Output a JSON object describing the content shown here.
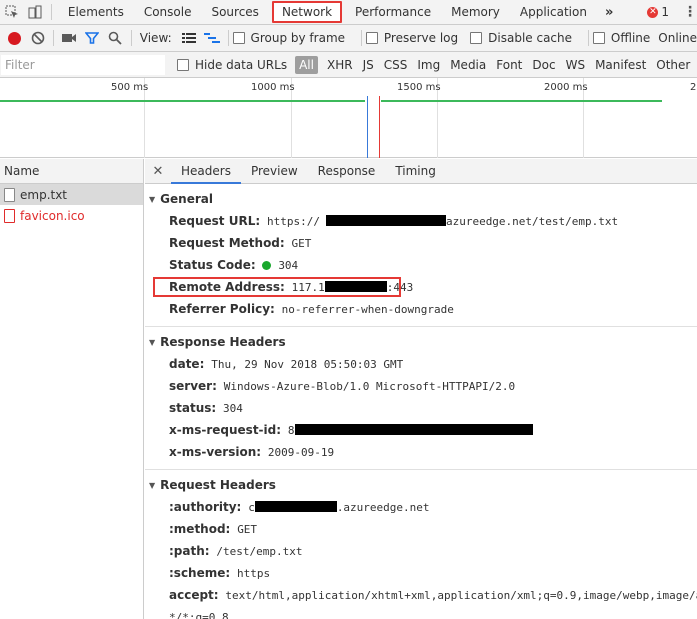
{
  "tabs": [
    "Elements",
    "Console",
    "Sources",
    "Network",
    "Performance",
    "Memory",
    "Application"
  ],
  "more": "»",
  "error_count": "1",
  "error_glyph": "✕",
  "toolbar": {
    "view_label": "View:",
    "group_by_frame": "Group by frame",
    "preserve_log": "Preserve log",
    "disable_cache": "Disable cache",
    "offline": "Offline",
    "online": "Online"
  },
  "filter": {
    "placeholder": "Filter",
    "hide_data_urls": "Hide data URLs",
    "types": [
      "All",
      "XHR",
      "JS",
      "CSS",
      "Img",
      "Media",
      "Font",
      "Doc",
      "WS",
      "Manifest",
      "Other"
    ]
  },
  "overview": {
    "ticks": [
      "500 ms",
      "1000 ms",
      "1500 ms",
      "2000 ms",
      "2"
    ]
  },
  "names": {
    "header": "Name",
    "rows": [
      "emp.txt",
      "favicon.ico"
    ]
  },
  "detail_tabs": [
    "Headers",
    "Preview",
    "Response",
    "Timing"
  ],
  "general": {
    "title": "General",
    "request_url_k": "Request URL:",
    "request_url_v1": "https://",
    "request_url_v2": "azureedge.net/test/emp.txt",
    "request_method_k": "Request Method:",
    "request_method_v": "GET",
    "status_code_k": "Status Code:",
    "status_code_v": "304",
    "remote_address_k": "Remote Address:",
    "remote_address_v1": "117.1",
    "remote_address_v2": ":443",
    "referrer_policy_k": "Referrer Policy:",
    "referrer_policy_v": "no-referrer-when-downgrade"
  },
  "response_headers": {
    "title": "Response Headers",
    "date_k": "date:",
    "date_v": "Thu, 29 Nov 2018 05:50:03 GMT",
    "server_k": "server:",
    "server_v": "Windows-Azure-Blob/1.0 Microsoft-HTTPAPI/2.0",
    "status_k": "status:",
    "status_v": "304",
    "request_id_k": "x-ms-request-id:",
    "request_id_v": "8",
    "version_k": "x-ms-version:",
    "version_v": "2009-09-19"
  },
  "request_headers": {
    "title": "Request Headers",
    "authority_k": ":authority:",
    "authority_v1": "c",
    "authority_v2": ".azureedge.net",
    "method_k": ":method:",
    "method_v": "GET",
    "path_k": ":path:",
    "path_v": "/test/emp.txt",
    "scheme_k": ":scheme:",
    "scheme_v": "https",
    "accept_k": "accept:",
    "accept_v": "text/html,application/xhtml+xml,application/xml;q=0.9,image/webp,image/ap",
    "accept_v2": "*/*;q=0.8"
  },
  "colors": {
    "record": "#d71920",
    "highlight": "#e53935",
    "status_ok": "#1aa82e",
    "timeline_green": "#3cb95b",
    "active_tab_underline": "#3879d9"
  }
}
